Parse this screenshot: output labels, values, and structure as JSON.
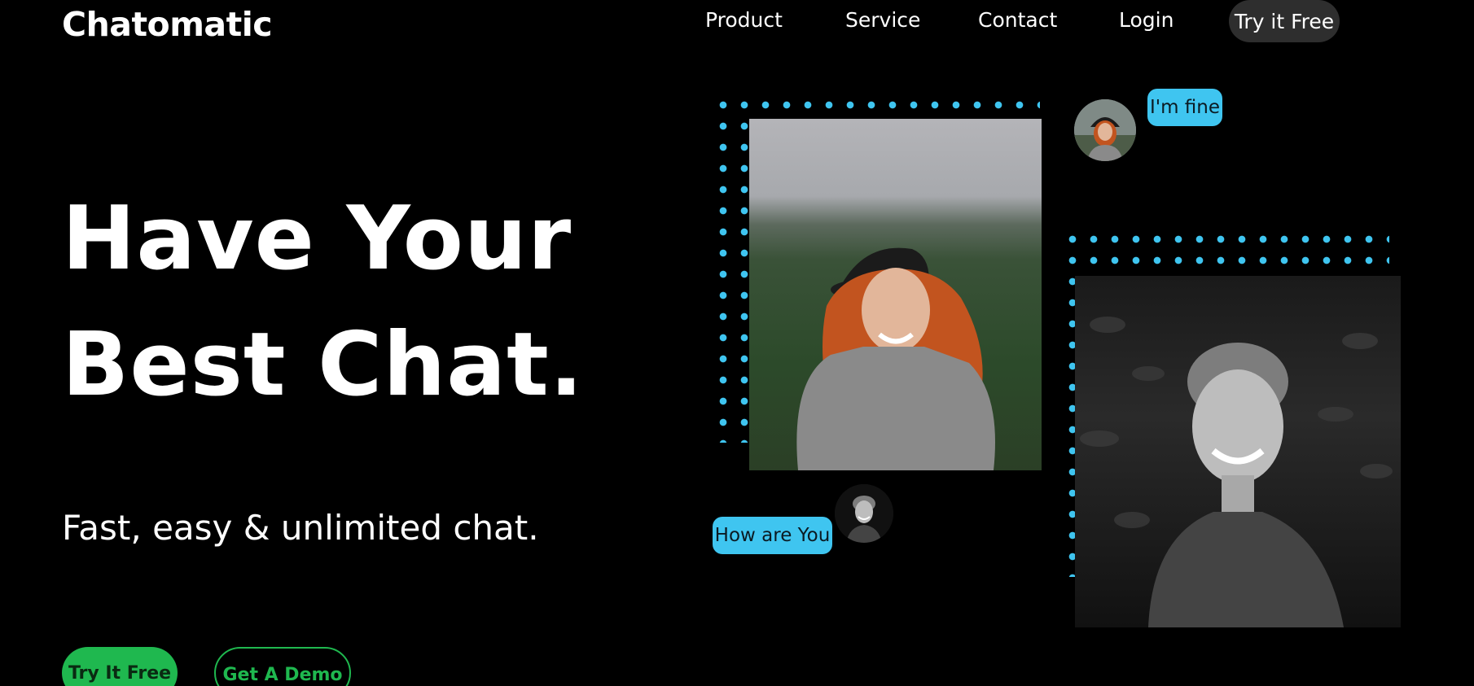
{
  "header": {
    "logo": "Chatomatic",
    "nav": [
      "Product",
      "Service",
      "Contact",
      "Login"
    ],
    "cta_label": "Try it Free"
  },
  "hero": {
    "title_line1": "Have Your",
    "title_line2": "Best Chat.",
    "subtitle": "Fast, easy & unlimited chat.",
    "primary_button": "Try It Free",
    "secondary_button": "Get A Demo"
  },
  "chat": {
    "message_1": "I'm fine",
    "message_2": "How are You"
  },
  "colors": {
    "background": "#000000",
    "accent_cyan": "#3fc5f0",
    "accent_green": "#1fb84f",
    "nav_cta_bg": "#2e2e2e"
  },
  "icons": {
    "photo_woman": "smiling-woman-photo",
    "photo_man": "smiling-man-photo",
    "avatar_woman": "woman-avatar",
    "avatar_man": "man-avatar"
  }
}
